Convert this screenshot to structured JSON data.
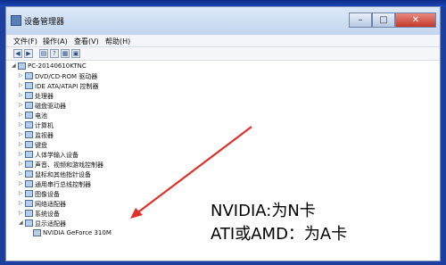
{
  "window": {
    "title": "设备管理器",
    "controls": {
      "minimize": "–",
      "maximize": "□",
      "close": "✕"
    }
  },
  "menubar": [
    "文件(F)",
    "操作(A)",
    "查看(V)",
    "帮助(H)"
  ],
  "toolbar_icons": [
    "back-icon",
    "forward-icon",
    "properties-icon",
    "help-icon",
    "scan-icon",
    "view-icon"
  ],
  "tree": {
    "root": "PC-20140610KTNC",
    "items": [
      "DVD/CD-ROM 驱动器",
      "IDE ATA/ATAPI 控制器",
      "处理器",
      "磁盘驱动器",
      "电池",
      "计算机",
      "监视器",
      "键盘",
      "人体学输入设备",
      "声音、视频和游戏控制器",
      "鼠标和其他指针设备",
      "通用串行总线控制器",
      "图像设备",
      "网络适配器",
      "系统设备",
      "显示适配器"
    ],
    "expanded_child": "NVIDIA GeForce 310M"
  },
  "annotation": {
    "line1": "NVIDIA:为N卡",
    "line2": "ATI或AMD：为A卡",
    "arrow_color": "#e0302a"
  }
}
